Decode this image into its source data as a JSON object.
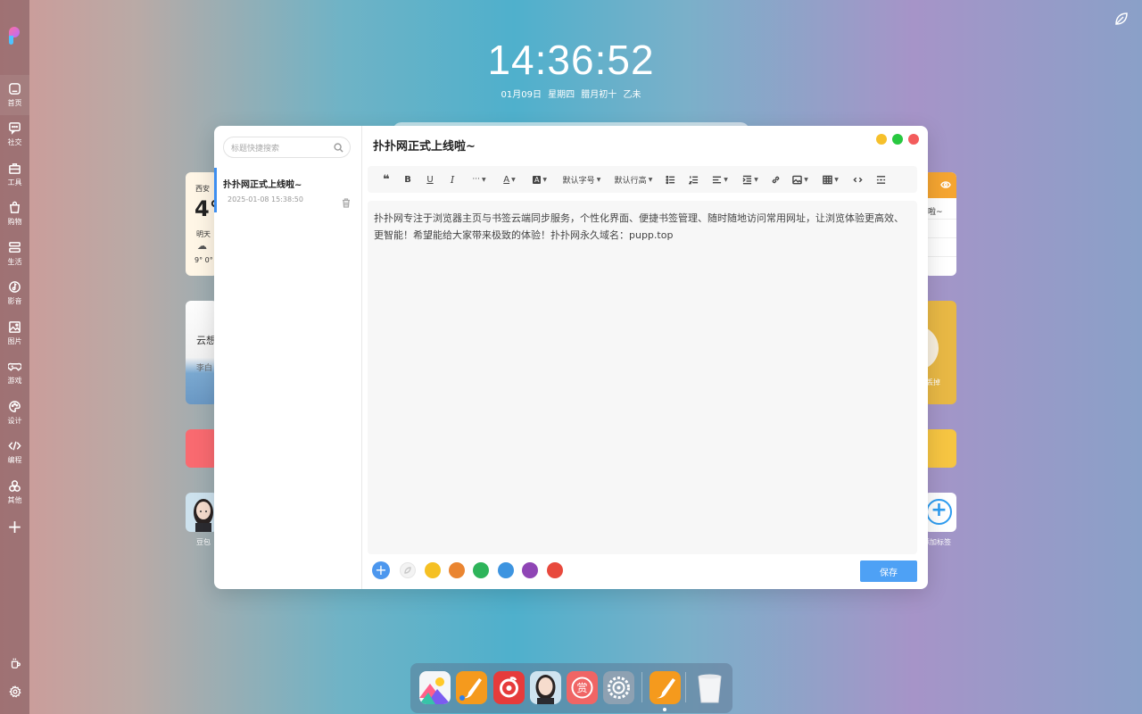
{
  "clock": {
    "time": "14:36:52",
    "date": "01月09日  星期四  腊月初十  乙未"
  },
  "sidebar": {
    "items": [
      {
        "label": "首页",
        "icon": "home-icon"
      },
      {
        "label": "社交",
        "icon": "chat-icon"
      },
      {
        "label": "工具",
        "icon": "toolbox-icon"
      },
      {
        "label": "购物",
        "icon": "bag-icon"
      },
      {
        "label": "生活",
        "icon": "life-icon"
      },
      {
        "label": "影音",
        "icon": "music-icon"
      },
      {
        "label": "图片",
        "icon": "image-icon"
      },
      {
        "label": "游戏",
        "icon": "gamepad-icon"
      },
      {
        "label": "设计",
        "icon": "palette-icon"
      },
      {
        "label": "编程",
        "icon": "code-icon"
      },
      {
        "label": "其他",
        "icon": "shapes-icon"
      }
    ]
  },
  "widgets": {
    "weather": {
      "city": "西安",
      "temp": "4°",
      "tomorrow": "明天",
      "range": "9° 0°"
    },
    "poem": {
      "line1": "云想",
      "line2": "李白"
    },
    "avatar_label": "豆包",
    "note_preview": "啦~",
    "yellow_label": "丢掉",
    "add_label": "添加标签"
  },
  "note_window": {
    "search": {
      "placeholder": "标题快捷搜索"
    },
    "notes": [
      {
        "title": "扑扑网正式上线啦~",
        "time": "2025-01-08 15:38:50"
      }
    ],
    "title": "扑扑网正式上线啦~",
    "toolbar": {
      "font_size_label": "默认字号",
      "line_height_label": "默认行高"
    },
    "content": "扑扑网专注于浏览器主页与书签云端同步服务，个性化界面、便捷书签管理、随时随地访问常用网址，让浏览体验更高效、更智能！希望能给大家带来极致的体验！扑扑网永久域名：pupp.top",
    "colors": [
      "#f5c023",
      "#ea8531",
      "#2eb45a",
      "#3d94e0",
      "#8f45b5",
      "#e8493d"
    ],
    "save_label": "保存"
  },
  "window_controls": {
    "minimize": "#f6c02b",
    "maximize": "#28c840",
    "close": "#f35c5c"
  },
  "dock": {
    "apps": [
      "gallery-app-icon",
      "brush-app-icon",
      "netease-music-icon",
      "doubao-avatar-icon",
      "reward-app-icon",
      "settings-app-icon",
      "brush-active-icon",
      "trash-icon"
    ]
  }
}
